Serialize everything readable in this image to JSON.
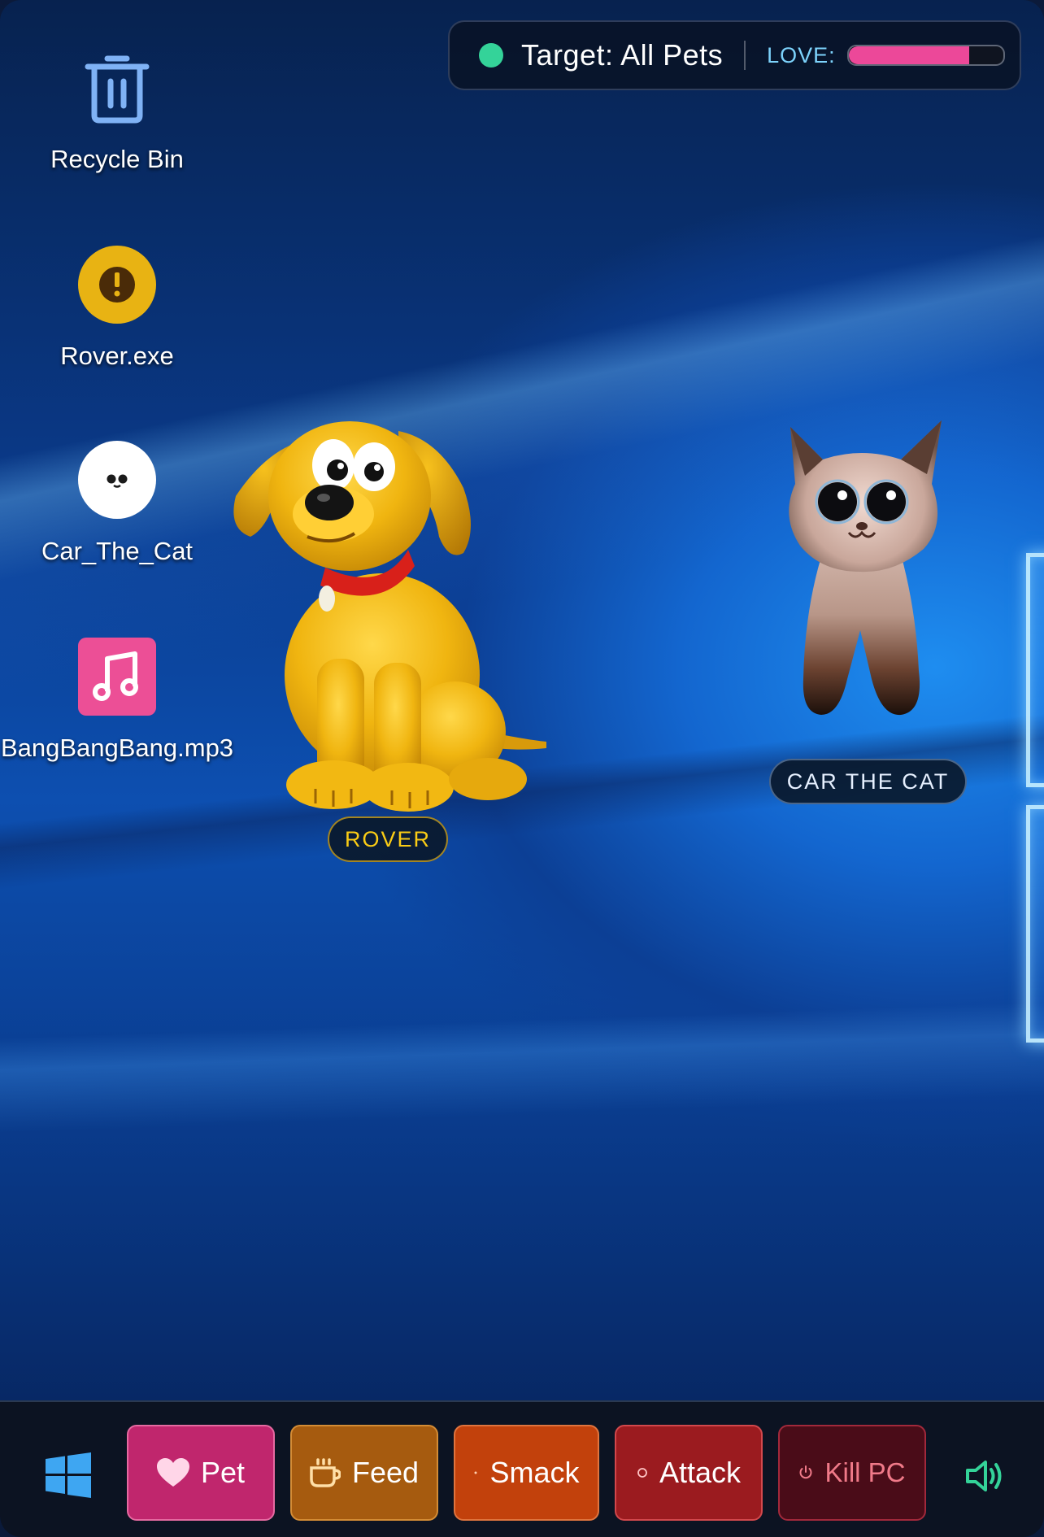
{
  "desktop": {
    "icons": [
      {
        "label": "Recycle Bin",
        "icon": "trash-icon"
      },
      {
        "label": "Rover.exe",
        "icon": "warning-icon"
      },
      {
        "label": "Car_The_Cat",
        "icon": "cat-face-icon"
      },
      {
        "label": "BangBangBang.mp3",
        "icon": "music-note-icon"
      }
    ]
  },
  "status": {
    "target_text": "Target: All Pets",
    "love_label": "LOVE:",
    "love_level": 0.78,
    "dot_color": "#34d399",
    "love_color": "#ec4899"
  },
  "pets": [
    {
      "name": "ROVER",
      "kind": "dog"
    },
    {
      "name": "CAR THE CAT",
      "kind": "cat"
    }
  ],
  "taskbar": {
    "start_icon": "windows-logo-icon",
    "buttons": [
      {
        "label": "Pet",
        "icon": "heart-icon",
        "color": "#c0266d"
      },
      {
        "label": "Feed",
        "icon": "cup-icon",
        "color": "#a65b0f"
      },
      {
        "label": "Smack",
        "icon": "dot-icon",
        "color": "#c2410c"
      },
      {
        "label": "Attack",
        "icon": "target-icon",
        "color": "#9b1b1f"
      },
      {
        "label": "Kill PC",
        "icon": "power-icon",
        "color": "#4a0c18"
      }
    ],
    "volume_icon": "speaker-icon"
  }
}
